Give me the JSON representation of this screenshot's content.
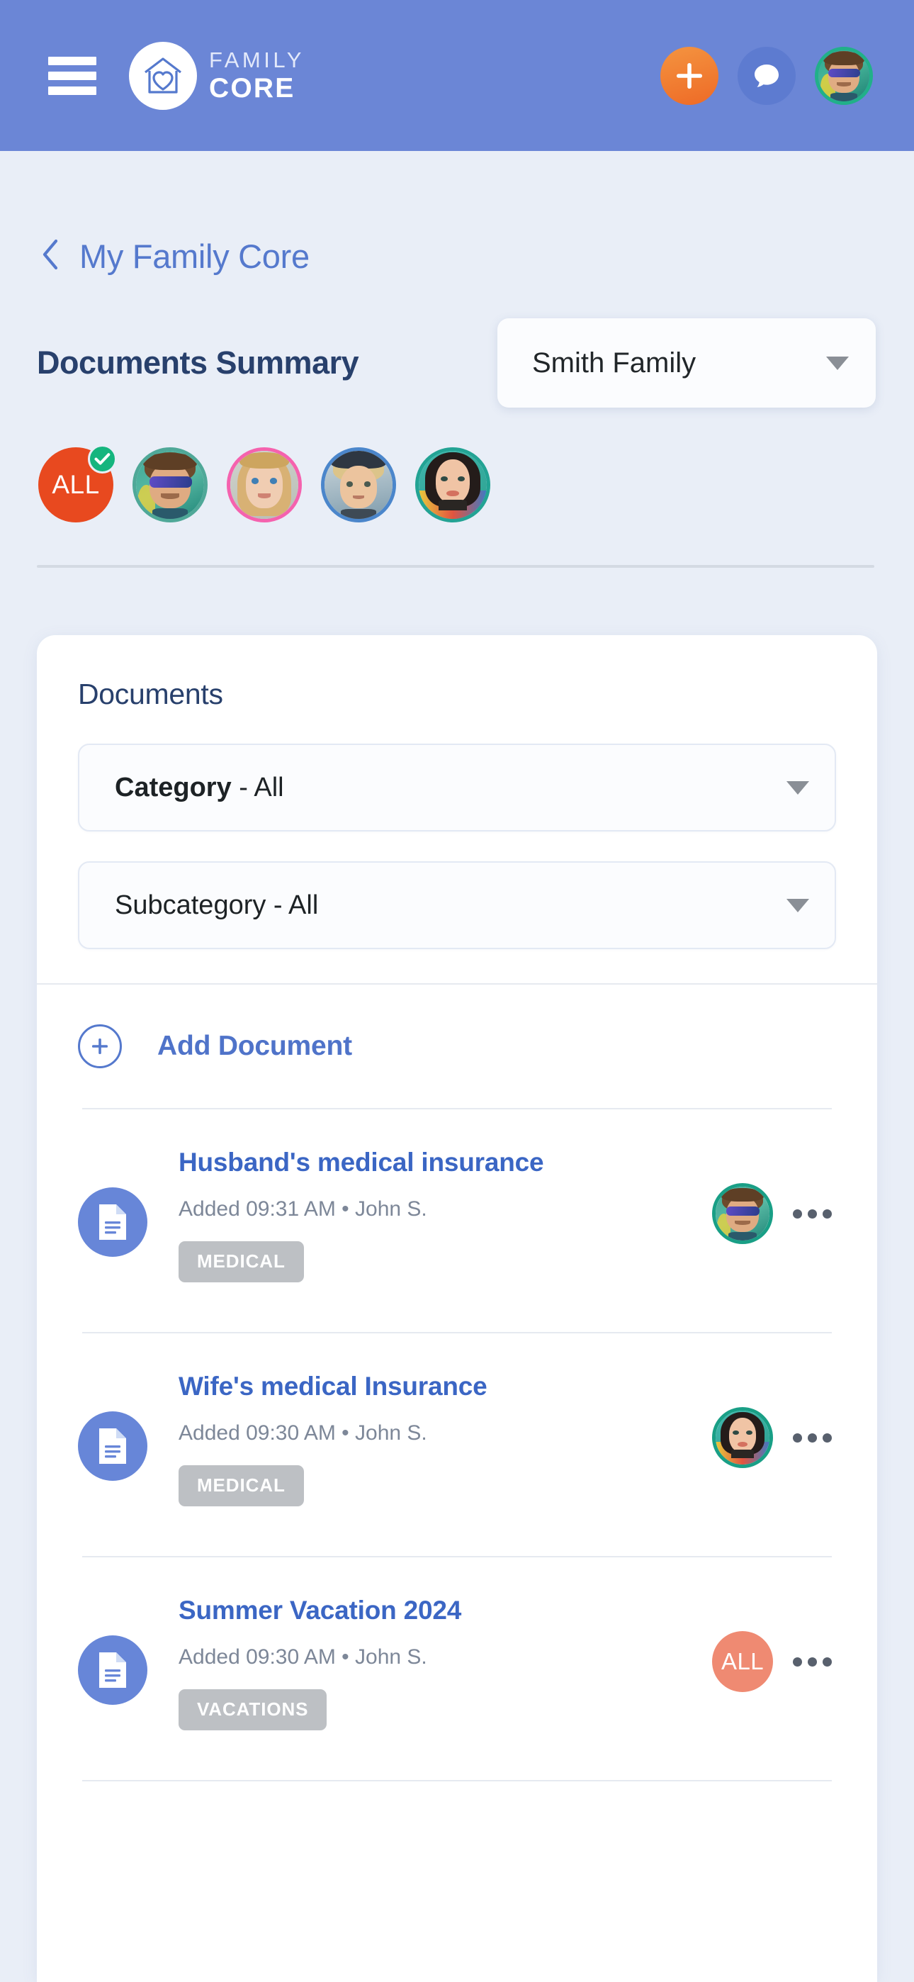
{
  "appbar": {
    "menu_icon": "hamburger-menu-icon",
    "brand_top": "FAMILY",
    "brand_bottom": "CORE",
    "logo_icon": "house-heart-logo-icon",
    "add_icon": "plus-icon",
    "chat_icon": "chat-bubble-icon",
    "profile_icon": "user-avatar-icon"
  },
  "breadcrumb": {
    "back_icon": "chevron-left-icon",
    "label": "My Family Core"
  },
  "summary": {
    "title": "Documents Summary",
    "family_selected": "Smith Family",
    "dropdown_icon": "caret-down-icon"
  },
  "members": [
    {
      "label": "ALL",
      "type": "all",
      "selected": true,
      "check_icon": "check-icon"
    },
    {
      "label": "",
      "type": "photo",
      "ring": "#4fa898",
      "selected": false
    },
    {
      "label": "",
      "type": "photo",
      "ring": "#f562ae",
      "selected": false
    },
    {
      "label": "",
      "type": "photo",
      "ring": "#4b86cb",
      "selected": false
    },
    {
      "label": "",
      "type": "photo",
      "ring": "#23a394",
      "selected": false
    }
  ],
  "documents_card": {
    "title": "Documents",
    "category_filter": {
      "bold": "Category",
      "rest": " - All"
    },
    "subcategory_filter": {
      "bold": "",
      "rest": "Subcategory - All"
    },
    "add_document_label": "Add Document",
    "add_icon": "plus-circle-icon",
    "rows": [
      {
        "icon": "document-file-icon",
        "title": "Husband's medical insurance",
        "meta": "Added 09:31 AM • John S.",
        "tag": "MEDICAL",
        "owner_type": "photo",
        "owner_label": "",
        "menu_icon": "kebab-menu-icon"
      },
      {
        "icon": "document-file-icon",
        "title": "Wife's medical Insurance",
        "meta": "Added 09:30 AM • John S.",
        "tag": "MEDICAL",
        "owner_type": "photo",
        "owner_label": "",
        "menu_icon": "kebab-menu-icon"
      },
      {
        "icon": "document-file-icon",
        "title": "Summer Vacation 2024",
        "meta": "Added 09:30 AM • John S.",
        "tag": "VACATIONS",
        "owner_type": "all",
        "owner_label": "ALL",
        "menu_icon": "kebab-menu-icon"
      }
    ]
  },
  "colors": {
    "appbar": "#6b86d6",
    "page_bg": "#e9eef7",
    "accent_orange": "#ee6a26",
    "accent_red": "#e8491f",
    "link_blue": "#3b66c4",
    "title_navy": "#28406c",
    "tag_gray": "#bdc0c4",
    "check_green": "#15b57e",
    "row_all_salmon": "#ef8a72"
  }
}
